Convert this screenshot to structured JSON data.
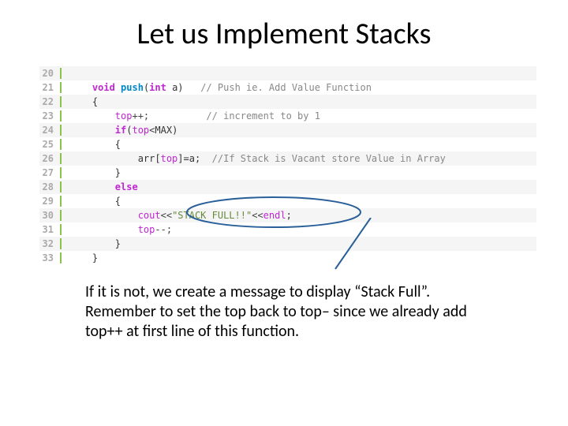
{
  "title": "Let us Implement Stacks",
  "code": {
    "lines": [
      {
        "n": "20",
        "stripe": true,
        "tokens": []
      },
      {
        "n": "21",
        "stripe": false,
        "tokens": [
          {
            "c": "kw",
            "t": "    void "
          },
          {
            "c": "fn",
            "t": "push"
          },
          {
            "c": "plain",
            "t": "("
          },
          {
            "c": "kw",
            "t": "int"
          },
          {
            "c": "plain",
            "t": " a)   "
          },
          {
            "c": "cm",
            "t": "// Push ie. Add Value Function"
          }
        ]
      },
      {
        "n": "22",
        "stripe": true,
        "tokens": [
          {
            "c": "plain",
            "t": "    {"
          }
        ]
      },
      {
        "n": "23",
        "stripe": false,
        "tokens": [
          {
            "c": "plain",
            "t": "        "
          },
          {
            "c": "var",
            "t": "top"
          },
          {
            "c": "op",
            "t": "++;"
          },
          {
            "c": "plain",
            "t": "          "
          },
          {
            "c": "cm",
            "t": "// increment to by 1"
          }
        ]
      },
      {
        "n": "24",
        "stripe": true,
        "tokens": [
          {
            "c": "plain",
            "t": "        "
          },
          {
            "c": "kw",
            "t": "if"
          },
          {
            "c": "plain",
            "t": "("
          },
          {
            "c": "var",
            "t": "top"
          },
          {
            "c": "op",
            "t": "<"
          },
          {
            "c": "plain",
            "t": "MAX)"
          }
        ]
      },
      {
        "n": "25",
        "stripe": false,
        "tokens": [
          {
            "c": "plain",
            "t": "        {"
          }
        ]
      },
      {
        "n": "26",
        "stripe": true,
        "tokens": [
          {
            "c": "plain",
            "t": "            arr["
          },
          {
            "c": "var",
            "t": "top"
          },
          {
            "c": "plain",
            "t": "]=a;  "
          },
          {
            "c": "cm",
            "t": "//If Stack is Vacant store Value in Array"
          }
        ]
      },
      {
        "n": "27",
        "stripe": false,
        "tokens": [
          {
            "c": "plain",
            "t": "        }"
          }
        ]
      },
      {
        "n": "28",
        "stripe": true,
        "tokens": [
          {
            "c": "plain",
            "t": "        "
          },
          {
            "c": "kw",
            "t": "else"
          }
        ]
      },
      {
        "n": "29",
        "stripe": false,
        "tokens": [
          {
            "c": "plain",
            "t": "        {"
          }
        ]
      },
      {
        "n": "30",
        "stripe": true,
        "tokens": [
          {
            "c": "plain",
            "t": "            "
          },
          {
            "c": "var",
            "t": "cout"
          },
          {
            "c": "op",
            "t": "<<"
          },
          {
            "c": "str",
            "t": "\"STACK FULL!!\""
          },
          {
            "c": "op",
            "t": "<<"
          },
          {
            "c": "var",
            "t": "endl"
          },
          {
            "c": "plain",
            "t": ";"
          }
        ]
      },
      {
        "n": "31",
        "stripe": false,
        "tokens": [
          {
            "c": "plain",
            "t": "            "
          },
          {
            "c": "var",
            "t": "top"
          },
          {
            "c": "op",
            "t": "--;"
          }
        ]
      },
      {
        "n": "32",
        "stripe": true,
        "tokens": [
          {
            "c": "plain",
            "t": "        }"
          }
        ]
      },
      {
        "n": "33",
        "stripe": false,
        "tokens": [
          {
            "c": "plain",
            "t": "    }"
          }
        ]
      }
    ]
  },
  "explain": {
    "p1": "If it is not, we create a message to display “Stack Full”.",
    "p2": "Remember to set the top back to top– since we already add top++ at first line of this function."
  },
  "colors": {
    "ellipse": "#2a6099",
    "arrow": "#2a6099"
  }
}
